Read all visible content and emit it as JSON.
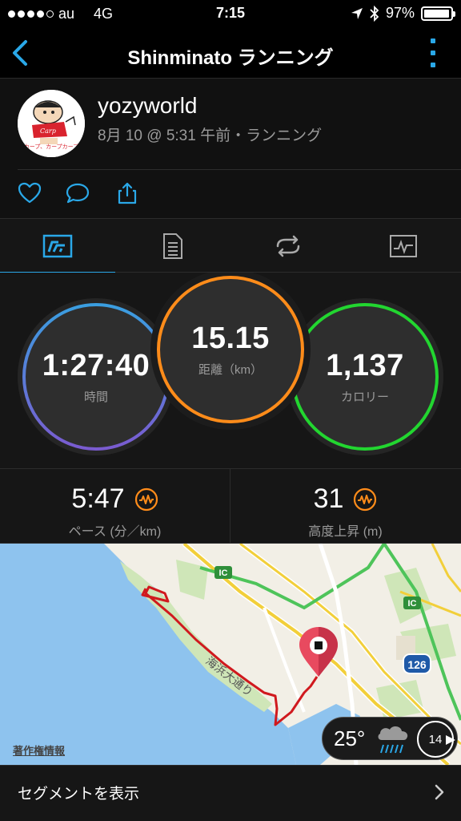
{
  "status_bar": {
    "carrier": "au",
    "network": "4G",
    "time": "7:15",
    "battery": "97%",
    "signal_bars": 4,
    "battery_level": 0.97
  },
  "nav": {
    "title": "Shinminato ランニング"
  },
  "profile": {
    "username": "yozyworld",
    "meta": "8月 10 @ 5:31 午前・ランニング",
    "avatar_caption": "カープ、カープカープ"
  },
  "actions": [
    "heart-icon",
    "comment-icon",
    "share-icon"
  ],
  "tabs": [
    {
      "icon": "summary-chart-icon",
      "active": true
    },
    {
      "icon": "details-list-icon",
      "active": false
    },
    {
      "icon": "laps-loop-icon",
      "active": false
    },
    {
      "icon": "graph-icon",
      "active": false
    }
  ],
  "stats": {
    "time": {
      "value": "1:27:40",
      "label": "時間"
    },
    "distance": {
      "value": "15.15",
      "label": "距離（km）"
    },
    "calories": {
      "value": "1,137",
      "label": "カロリー"
    }
  },
  "metrics": {
    "pace": {
      "value": "5:47",
      "label": "ペース (分／km)"
    },
    "elevation": {
      "value": "31",
      "label": "高度上昇 (m)"
    }
  },
  "map": {
    "road_label": "海浜大通り",
    "interchange_label": "IC",
    "route_number": "126",
    "copyright": "著作権情報"
  },
  "weather": {
    "temperature": "25°",
    "wind": "14",
    "icon": "rain-cloud-icon"
  },
  "segments": {
    "label": "セグメントを表示"
  },
  "colors": {
    "accent": "#2aa8e8",
    "time_ring_start": "#3a9ee0",
    "time_ring_end": "#7a5bd0",
    "distance_ring": "#ff8c1a",
    "calories_ring": "#22d630",
    "route": "#d0191e",
    "pin": "#e84a5f"
  }
}
